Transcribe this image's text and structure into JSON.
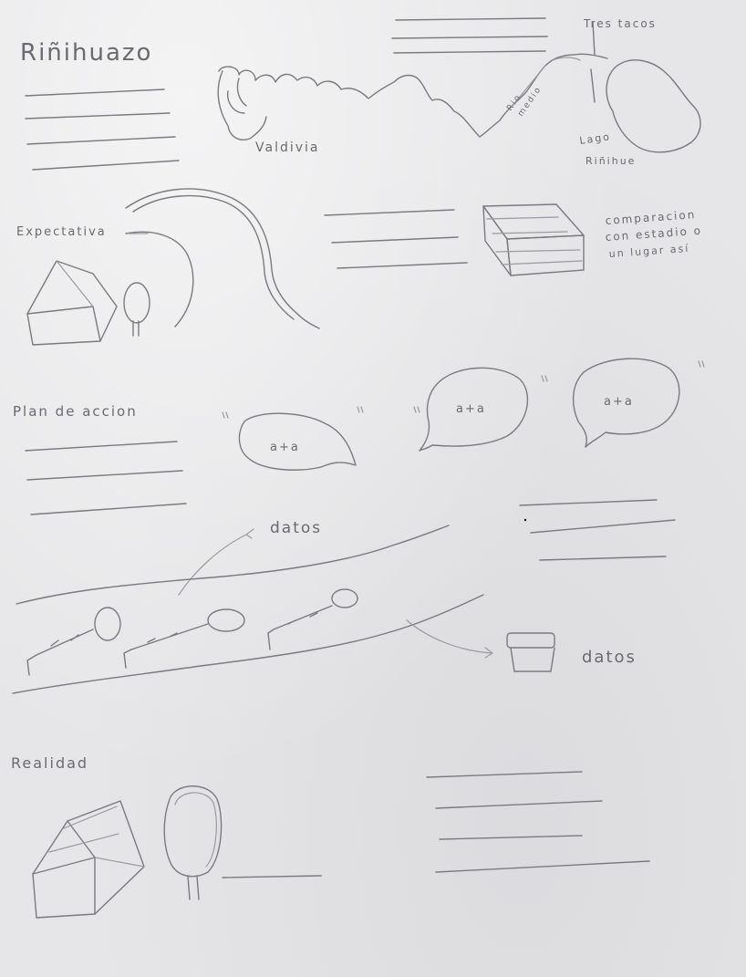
{
  "title": "Riñihuazo",
  "map": {
    "label_valdivia": "Valdivia",
    "label_rio": "Rio",
    "label_medio": "medio",
    "label_tres_tacos": "Tres tacos",
    "label_lago": "Lago",
    "label_rinihue": "Riñihue"
  },
  "expectativa": {
    "heading": "Expectativa",
    "comparison_line1": "comparacion",
    "comparison_line2": "con estadio o",
    "comparison_line3": "un lugar así"
  },
  "plan": {
    "heading": "Plan de accion",
    "bubble_text": "a+a",
    "label_datos_top": "datos",
    "label_datos_bucket": "datos"
  },
  "realidad": {
    "heading": "Realidad"
  }
}
